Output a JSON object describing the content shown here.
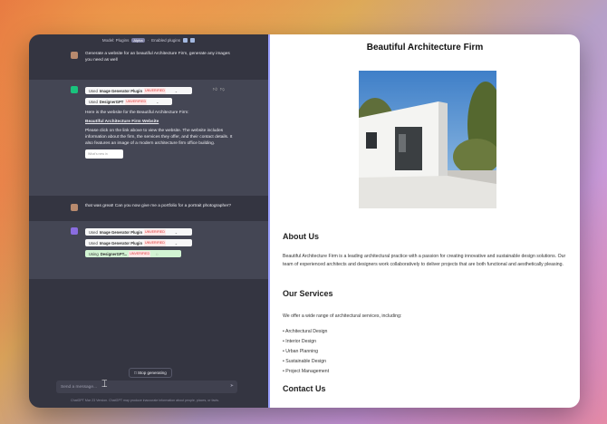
{
  "chat": {
    "model_label": "Model: Plugins",
    "model_badge": "Alpha",
    "enabled_plugins_label": "Enabled plugins",
    "messages": [
      {
        "role": "user",
        "text": "Generate a website for an beautiful Architecture Firm, generate any images you need as well"
      },
      {
        "role": "assistant",
        "plugins": [
          {
            "prefix": "Used",
            "name": "Image Generator Plugin",
            "badge": "UNVERIFIED"
          },
          {
            "prefix": "Used",
            "name": "DesignerGPT",
            "badge": "UNVERIFIED"
          }
        ],
        "intro": "Here is the website for the Beautiful Architecture Firm:",
        "link": "Beautiful Architecture Firm Website",
        "body": "Please click on the link above to view the website. The website includes information about the firm, the services they offer, and their contact details. It also features an image of a modern architecture firm office building.",
        "thumb": "What's new in"
      },
      {
        "role": "user",
        "text": "that was great! Can you now give me a portfolio for a portrait photographer?"
      },
      {
        "role": "assistant",
        "plugins": [
          {
            "prefix": "Used",
            "name": "Image Generator Plugin",
            "badge": "UNVERIFIED"
          },
          {
            "prefix": "Used",
            "name": "Image Generator Plugin",
            "badge": "UNVERIFIED"
          },
          {
            "prefix": "Using",
            "name": "DesignerGPT...",
            "badge": "UNVERIFIED"
          }
        ]
      }
    ],
    "stop_label": "Stop generating",
    "input_placeholder": "Send a message...",
    "footer": "ChatGPT Mar 23 Version. ChatGPT may produce inaccurate information about people, places, or facts."
  },
  "site": {
    "title": "Beautiful Architecture Firm",
    "about_heading": "About Us",
    "about_text": "Beautiful Architecture Firm is a leading architectural practice with a passion for creating innovative and sustainable design solutions. Our team of experienced architects and designers work collaboratively to deliver projects that are both functional and aesthetically pleasing.",
    "services_heading": "Our Services",
    "services_intro": "We offer a wide range of architectural services, including:",
    "services": [
      "Architectural Design",
      "Interior Design",
      "Urban Planning",
      "Sustainable Design",
      "Project Management"
    ],
    "contact_heading": "Contact Us"
  }
}
